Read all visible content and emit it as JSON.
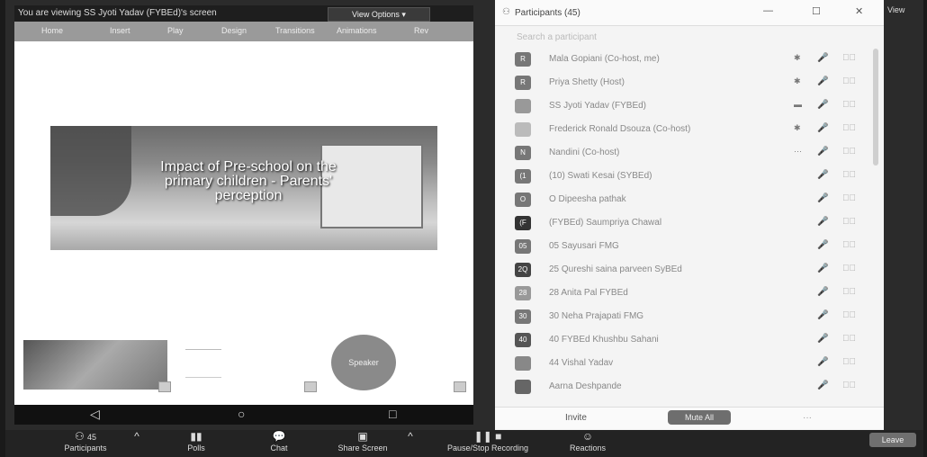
{
  "share_banner": {
    "text": "You are viewing SS Jyoti Yadav (FYBEd)'s screen",
    "view_options_label": "View Options ▾"
  },
  "ribbon_tabs": [
    "Home",
    "Insert",
    "Play",
    "Design",
    "Transitions",
    "Animations",
    "Rev"
  ],
  "slide": {
    "title_line1": "Impact of Pre-school on the",
    "title_line2": "primary children - Parents'",
    "title_line3": "perception"
  },
  "round_button_label": "Speaker",
  "android_nav": {
    "back": "◁",
    "home": "○",
    "recent": "□"
  },
  "participants": {
    "title": "Participants (45)",
    "minimize": "—",
    "maximize": "☐",
    "close": "✕",
    "search_placeholder": "Search a participant",
    "list": [
      {
        "initials": "R",
        "name": "Mala Gopiani (Co-host, me)",
        "extra": "✱"
      },
      {
        "initials": "R",
        "name": "Priya Shetty (Host)",
        "extra": "✱"
      },
      {
        "initials": "",
        "name": "SS Jyoti Yadav (FYBEd)",
        "extra": "▬"
      },
      {
        "initials": "",
        "name": "Frederick Ronald Dsouza (Co-host)",
        "extra": "✱"
      },
      {
        "initials": "N",
        "name": "Nandini (Co-host)",
        "extra": "···"
      },
      {
        "initials": "(1",
        "name": "(10) Swati Kesai (SYBEd)",
        "extra": ""
      },
      {
        "initials": "O",
        "name": "O Dipeesha pathak",
        "extra": ""
      },
      {
        "initials": "(F",
        "name": "(FYBEd) Saumpriya Chawal",
        "extra": ""
      },
      {
        "initials": "05",
        "name": "05 Sayusari FMG",
        "extra": ""
      },
      {
        "initials": "2Q",
        "name": "25 Qureshi saina parveen SyBEd",
        "extra": ""
      },
      {
        "initials": "28",
        "name": "28 Anita Pal FYBEd",
        "extra": ""
      },
      {
        "initials": "30",
        "name": "30 Neha Prajapati FMG",
        "extra": ""
      },
      {
        "initials": "40",
        "name": "40 FYBEd Khushbu Sahani",
        "extra": ""
      },
      {
        "initials": "",
        "name": "44 Vishal Yadav",
        "extra": ""
      },
      {
        "initials": "",
        "name": "Aarna Deshpande",
        "extra": ""
      }
    ],
    "mic_glyph": "🎤",
    "cam_glyph": "⊏⃞",
    "invite_label": "Invite",
    "mute_all_label": "Mute All",
    "more_label": "···"
  },
  "view_label": "View",
  "toolbar": {
    "participants_label": "Participants",
    "participants_count": "45",
    "polls_label": "Polls",
    "chat_label": "Chat",
    "share_label": "Share Screen",
    "record_label": "Pause/Stop Recording",
    "reactions_label": "Reactions",
    "leave_label": "Leave"
  }
}
